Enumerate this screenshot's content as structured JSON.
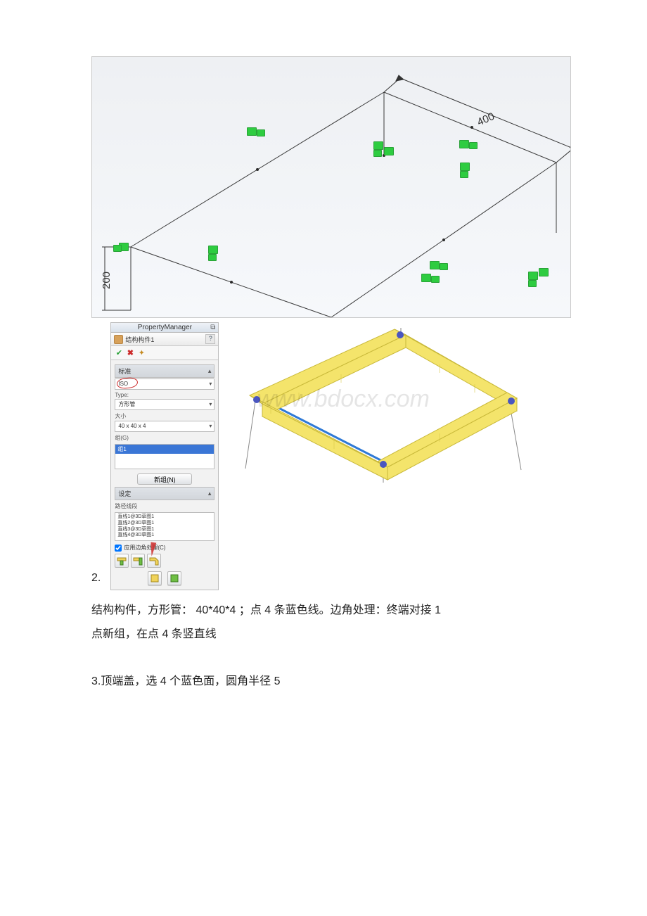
{
  "diagram": {
    "dim_height": "200",
    "dim_depth": "400"
  },
  "property_manager": {
    "title": "PropertyManager",
    "feature_name": "结构构件1",
    "section": {
      "standard_label": "标准",
      "standard_value": "ISO",
      "type_label": "Type:",
      "type_value": "方形管",
      "size_label": "大小",
      "size_value": "40 x 40 x 4",
      "group_label": "组(G)"
    },
    "list_active": "组1",
    "new_group_btn": "新组(N)",
    "settings_label": "设定",
    "path_label": "路径线段",
    "segments": [
      "直线1@3D草图1",
      "直线2@3D草图1",
      "直线3@3D草图1",
      "直线4@3D草图1"
    ],
    "apply_corner_label": "应用边角处理(C)"
  },
  "watermark": "www.bdocx.com",
  "text": {
    "num2": "2.",
    "para1a": "结构构件，方形管： 40*40*4 ；点 4 条蓝色线。边角处理：终端对接 1",
    "para1b": "点新组，在点 4 条竖直线",
    "para2": "3.顶端盖，选 4 个蓝色面，圆角半径 5"
  }
}
